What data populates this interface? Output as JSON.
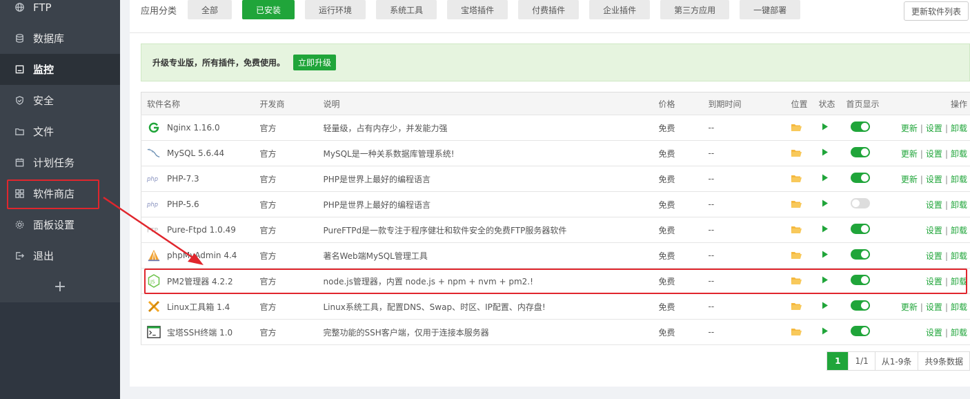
{
  "sidebar": {
    "items": [
      {
        "label": "FTP",
        "icon": "globe-icon"
      },
      {
        "label": "数据库",
        "icon": "database-icon"
      },
      {
        "label": "监控",
        "icon": "monitor-icon",
        "active": true
      },
      {
        "label": "安全",
        "icon": "shield-icon"
      },
      {
        "label": "文件",
        "icon": "folder-icon"
      },
      {
        "label": "计划任务",
        "icon": "calendar-icon"
      },
      {
        "label": "软件商店",
        "icon": "grid-icon"
      },
      {
        "label": "面板设置",
        "icon": "gear-icon"
      },
      {
        "label": "退出",
        "icon": "logout-icon"
      }
    ],
    "add": "+"
  },
  "category": {
    "label": "应用分类",
    "buttons": [
      "全部",
      "已安装",
      "运行环境",
      "系统工具",
      "宝塔插件",
      "付费插件",
      "企业插件",
      "第三方应用",
      "一键部署"
    ],
    "active_index": 1,
    "refresh": "更新软件列表"
  },
  "promo": {
    "text": "升级专业版，所有插件，免费使用。",
    "button": "立即升级"
  },
  "table": {
    "headers": {
      "name": "软件名称",
      "dev": "开发商",
      "desc": "说明",
      "price": "价格",
      "expire": "到期时间",
      "location": "位置",
      "status": "状态",
      "home": "首页显示",
      "ops": "操作"
    },
    "rows": [
      {
        "name": "Nginx 1.16.0",
        "dev": "官方",
        "desc": "轻量级，占有内存少，并发能力强",
        "price": "免费",
        "expire": "--",
        "home": true,
        "update": "更新",
        "settings": "设置",
        "uninstall": "卸载",
        "icon": "nginx-icon"
      },
      {
        "name": "MySQL 5.6.44",
        "dev": "官方",
        "desc": "MySQL是一种关系数据库管理系统!",
        "price": "免费",
        "expire": "--",
        "home": true,
        "update": "更新",
        "settings": "设置",
        "uninstall": "卸载",
        "icon": "mysql-icon"
      },
      {
        "name": "PHP-7.3",
        "dev": "官方",
        "desc": "PHP是世界上最好的编程语言",
        "price": "免费",
        "expire": "--",
        "home": true,
        "update": "更新",
        "settings": "设置",
        "uninstall": "卸载",
        "icon": "php-icon"
      },
      {
        "name": "PHP-5.6",
        "dev": "官方",
        "desc": "PHP是世界上最好的编程语言",
        "price": "免费",
        "expire": "--",
        "home": false,
        "update": "",
        "settings": "设置",
        "uninstall": "卸载",
        "icon": "php-icon"
      },
      {
        "name": "Pure-Ftpd 1.0.49",
        "dev": "官方",
        "desc": "PureFTPd是一款专注于程序健壮和软件安全的免费FTP服务器软件",
        "price": "免费",
        "expire": "--",
        "home": true,
        "update": "",
        "settings": "设置",
        "uninstall": "卸载",
        "icon": "ftp-icon"
      },
      {
        "name": "phpMyAdmin 4.4",
        "dev": "官方",
        "desc": "著名Web端MySQL管理工具",
        "price": "免费",
        "expire": "--",
        "home": true,
        "update": "",
        "settings": "设置",
        "uninstall": "卸载",
        "icon": "phpmyadmin-icon"
      },
      {
        "name": "PM2管理器 4.2.2",
        "dev": "官方",
        "desc": "node.js管理器，内置 node.js + npm + nvm + pm2.!",
        "price": "免费",
        "expire": "--",
        "home": true,
        "update": "",
        "settings": "设置",
        "uninstall": "卸载",
        "icon": "nodejs-icon"
      },
      {
        "name": "Linux工具箱 1.4",
        "dev": "官方",
        "desc": "Linux系统工具，配置DNS、Swap、时区、IP配置、内存盘!",
        "price": "免费",
        "expire": "--",
        "home": true,
        "update": "更新",
        "settings": "设置",
        "uninstall": "卸载",
        "icon": "tools-icon"
      },
      {
        "name": "宝塔SSH终端 1.0",
        "dev": "官方",
        "desc": "完整功能的SSH客户端，仅用于连接本服务器",
        "price": "免费",
        "expire": "--",
        "home": true,
        "update": "",
        "settings": "设置",
        "uninstall": "卸载",
        "icon": "terminal-icon"
      }
    ]
  },
  "pager": {
    "current": "1",
    "pages": "1/1",
    "range": "从1-9条",
    "total": "共9条数据"
  },
  "colors": {
    "accent": "#20a53a",
    "highlight": "#e0262d",
    "sidebar": "#2f3640"
  }
}
